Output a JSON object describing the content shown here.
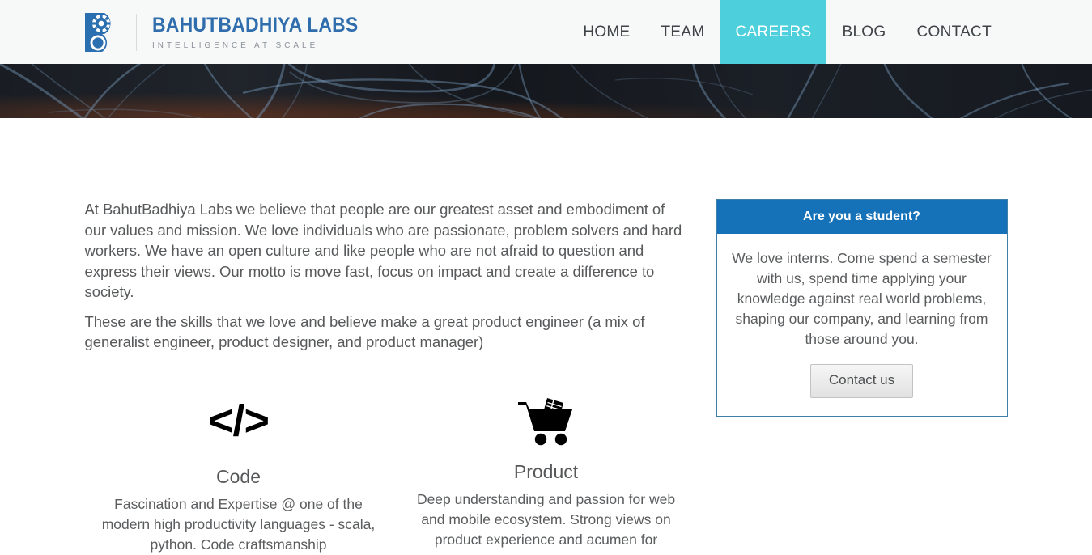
{
  "header": {
    "brand": {
      "logo_icon": "gear-b-logo-icon",
      "name": "BAHUTBADHIYA LABS",
      "tagline": "INTELLIGENCE AT SCALE",
      "name_color": "#2f6dad",
      "tagline_color": "#8a9299"
    },
    "nav": {
      "items": [
        {
          "label": "HOME",
          "active": false
        },
        {
          "label": "TEAM",
          "active": false
        },
        {
          "label": "CAREERS",
          "active": true
        },
        {
          "label": "BLOG",
          "active": false
        },
        {
          "label": "CONTACT",
          "active": false
        }
      ],
      "active_bg": "#4ecfdc",
      "active_text": "#ffffff"
    },
    "background": "#f7f8f8"
  },
  "hero": {
    "name": "abstract-blue-ribbons-banner",
    "background": "#14171c",
    "accent": "#5f7f9e"
  },
  "main": {
    "intro_paragraphs": [
      "At BahutBadhiya Labs we believe that people are our greatest asset and embodiment of our values and mission. We love individuals who are passionate, problem solvers and hard workers. We have an open culture and like people who are not afraid to question and express their views. Our motto is move fast, focus on impact and create a difference to society.",
      "These are the skills that we love and believe make a great product engineer (a mix of generalist engineer, product designer, and product manager)"
    ],
    "skills": [
      {
        "icon": "code-brackets-icon",
        "glyph": "</>",
        "title": "Code",
        "description": "Fascination and Expertise @ one of the modern high productivity languages - scala, python. Code craftsmanship"
      },
      {
        "icon": "shopping-cart-icon",
        "glyph": "",
        "title": "Product",
        "description": "Deep understanding and passion for web and mobile ecosystem. Strong views on product experience and acumen for"
      }
    ]
  },
  "sidebar": {
    "student_card": {
      "header_title": "Are you a student?",
      "header_bg": "#1572b8",
      "border_color": "#3d7fa6",
      "body_text": "We love interns. Come spend a semester with us, spend time applying your knowledge against real world problems, shaping our company, and learning from those around you.",
      "button_label": "Contact us"
    }
  }
}
